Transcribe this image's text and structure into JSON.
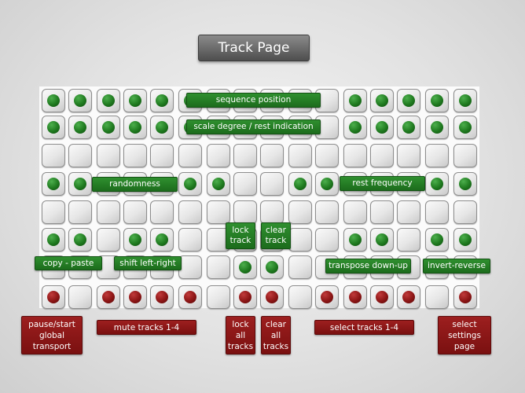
{
  "page": {
    "title": "Track Page"
  },
  "grid": {
    "rows": [
      [
        "g",
        "g",
        "g",
        "g",
        "g",
        "g",
        "",
        "",
        "",
        "",
        "",
        "g",
        "g",
        "g",
        "g",
        "g"
      ],
      [
        "g",
        "g",
        "g",
        "g",
        "g",
        "g",
        "",
        "",
        "",
        "",
        "",
        "g",
        "g",
        "g",
        "g",
        "g"
      ],
      [
        "",
        "",
        "",
        "",
        "",
        "",
        "",
        "",
        "",
        "",
        "",
        "",
        "",
        "",
        "",
        ""
      ],
      [
        "g",
        "g",
        "",
        "",
        "",
        "g",
        "g",
        "",
        "",
        "g",
        "g",
        "",
        "",
        "",
        "g",
        "g"
      ],
      [
        "",
        "",
        "",
        "",
        "",
        "",
        "",
        "",
        "",
        "",
        "",
        "",
        "",
        "",
        "",
        ""
      ],
      [
        "g",
        "g",
        "",
        "g",
        "g",
        "",
        "",
        "",
        "",
        "",
        "",
        "g",
        "g",
        "",
        "g",
        "g"
      ],
      [
        "",
        "",
        "",
        "",
        "",
        "",
        "",
        "g",
        "g",
        "",
        "",
        "",
        "",
        "",
        "",
        ""
      ],
      [
        "r",
        "",
        "r",
        "r",
        "r",
        "r",
        "",
        "r",
        "r",
        "",
        "r",
        "r",
        "r",
        "r",
        "",
        "r"
      ]
    ]
  },
  "annotations": {
    "sequence_position": "sequence position",
    "scale_degree": "scale degree / rest indication",
    "randomness": "randomness",
    "rest_frequency": "rest frequency",
    "lock_track": "lock track",
    "clear_track": "clear track",
    "copy_paste": "copy - paste",
    "shift_left_right": "shift left-right",
    "transpose_down_up": "transpose down-up",
    "invert_reverse": "invert-reverse"
  },
  "controls": {
    "pause_start": "pause/start global transport",
    "mute_tracks": "mute tracks 1-4",
    "lock_all": "lock all tracks",
    "clear_all": "clear all tracks",
    "select_tracks": "select tracks 1-4",
    "select_settings": "select settings page"
  },
  "colors": {
    "led_green": "#1f7a1f",
    "led_red": "#8c1515",
    "label_green": "#237a23",
    "label_red": "#8a1414",
    "title_bg": "#6a6a6a"
  }
}
